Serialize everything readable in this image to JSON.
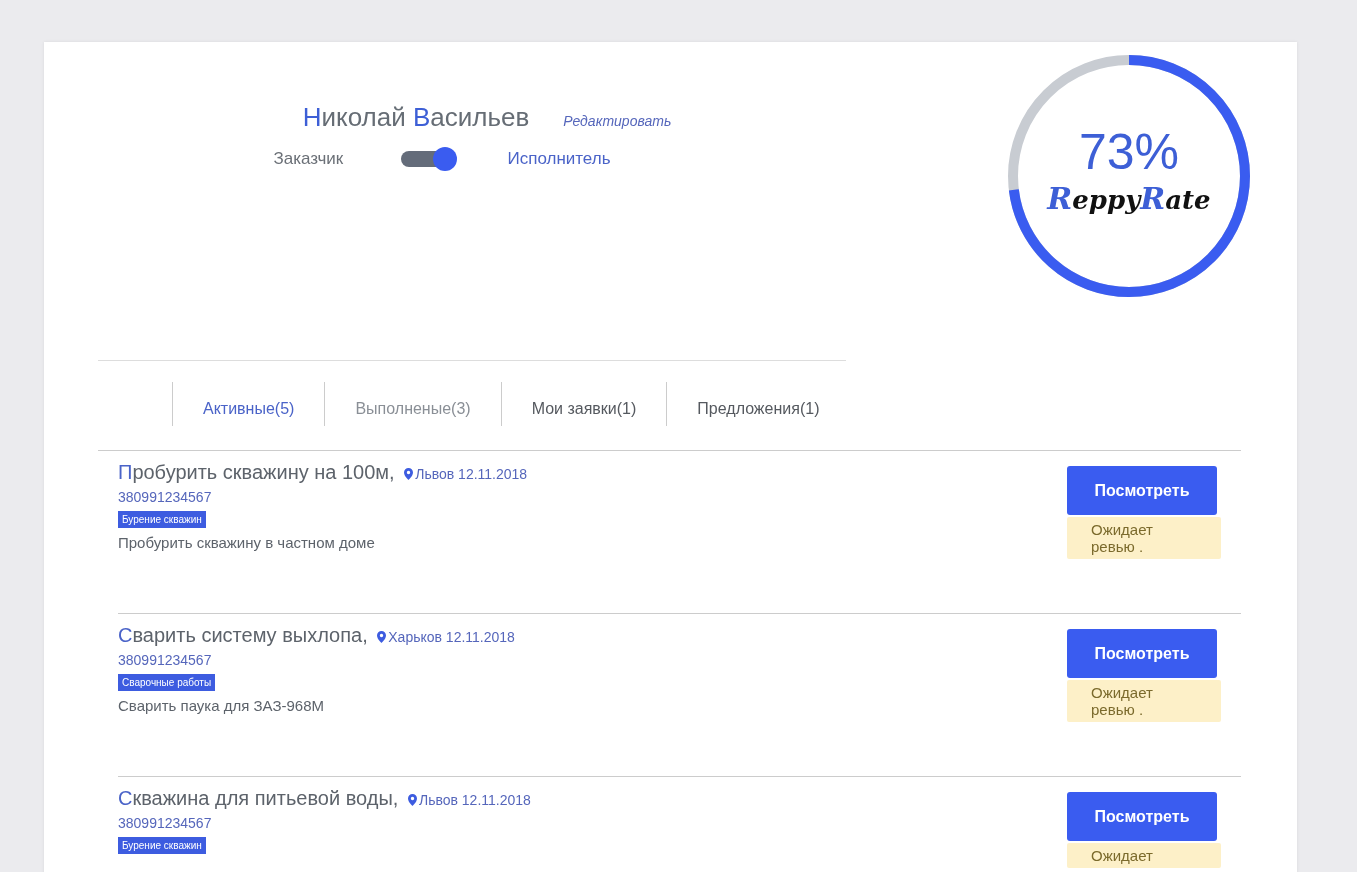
{
  "profile": {
    "first_name": "Николай",
    "last_name": "Васильев",
    "edit_link": "Редактировать",
    "role_left": "Заказчик",
    "role_right": "Исполнитель",
    "role_toggle_on": true
  },
  "rating": {
    "value": "73%",
    "level": 0.73,
    "logo_parts": [
      "Reppy",
      "Rate"
    ]
  },
  "tabs": [
    {
      "label": "Активные(5)",
      "selected": true
    },
    {
      "label": "Выполненые(3)",
      "selected": false,
      "disabled": true
    },
    {
      "label": "Мои заявки(1)",
      "selected": false,
      "disabled": false
    },
    {
      "label": "Предложения(1)",
      "selected": false,
      "disabled": false
    }
  ],
  "orders": [
    {
      "title": "Пробурить скважину на 100м,",
      "city": "Львов",
      "date": "12.11.2018",
      "phone": "380991234567",
      "tag": "Бурение скважин",
      "description": "Пробурить скважину в частном доме",
      "button": "Посмотреть",
      "status": "Ожидает ревью ."
    },
    {
      "title": "Сварить систему выхлопа,",
      "city": "Харьков",
      "date": "12.11.2018",
      "phone": "380991234567",
      "tag": "Сварочные работы",
      "description": "Сварить паука для ЗАЗ-968М",
      "button": "Посмотреть",
      "status": "Ожидает ревью ."
    },
    {
      "title": "Скважина для питьевой воды,",
      "city": "Львов",
      "date": "12.11.2018",
      "phone": "380991234567",
      "tag": "Бурение скважин",
      "button": "Посмотреть",
      "status": "Ожидает"
    }
  ]
}
